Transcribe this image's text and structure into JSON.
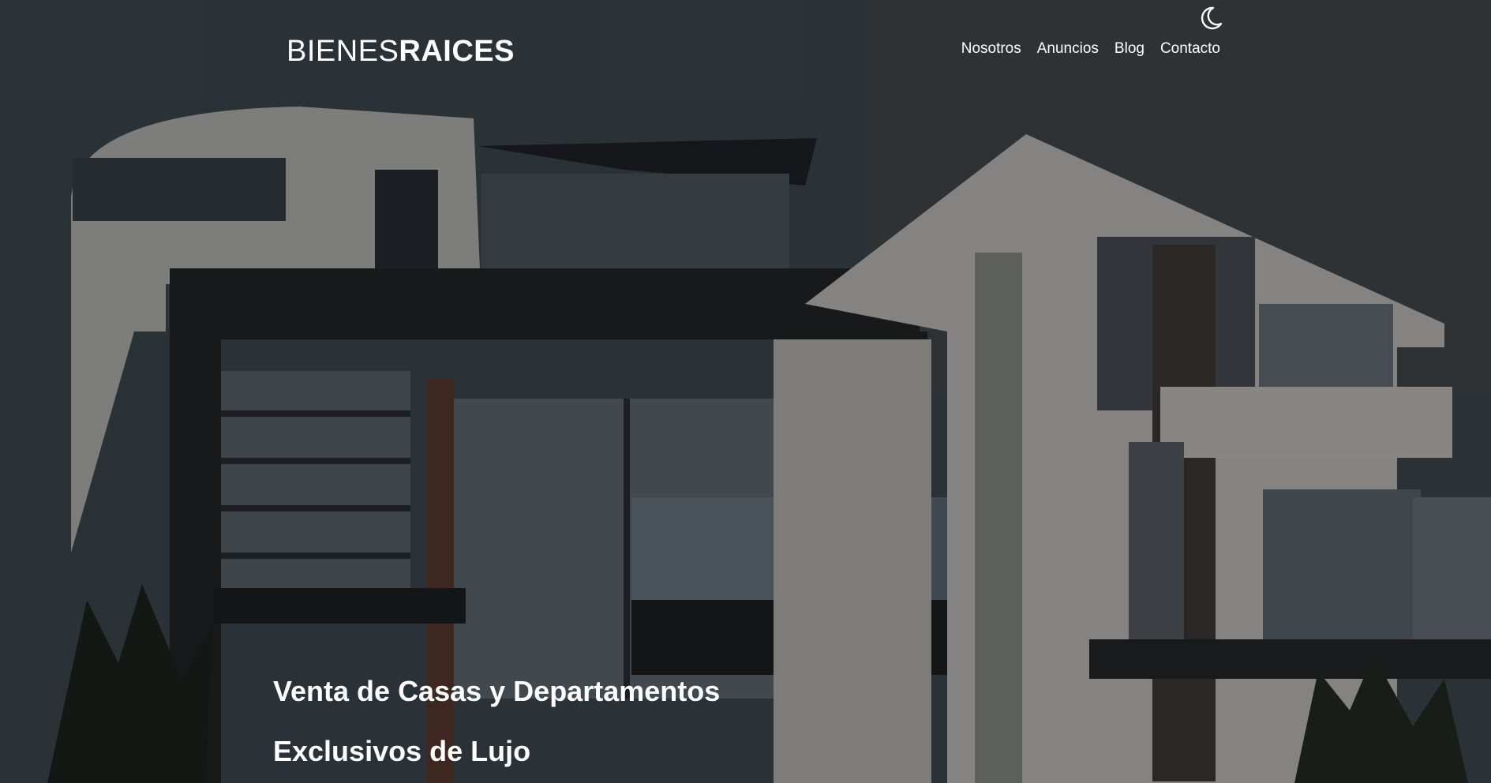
{
  "header": {
    "logo_light": "BIENES",
    "logo_bold": "RAICES",
    "theme_icon": "moon-icon",
    "nav": [
      {
        "label": "Nosotros"
      },
      {
        "label": "Anuncios"
      },
      {
        "label": "Blog"
      },
      {
        "label": "Contacto"
      }
    ]
  },
  "hero": {
    "title_line1": "Venta de Casas y Departamentos",
    "title_line2": "Exclusivos de Lujo",
    "background_image": "modern-house-photo"
  },
  "colors": {
    "text": "#ffffff",
    "overlay": "rgba(0,0,0,0.32)"
  }
}
